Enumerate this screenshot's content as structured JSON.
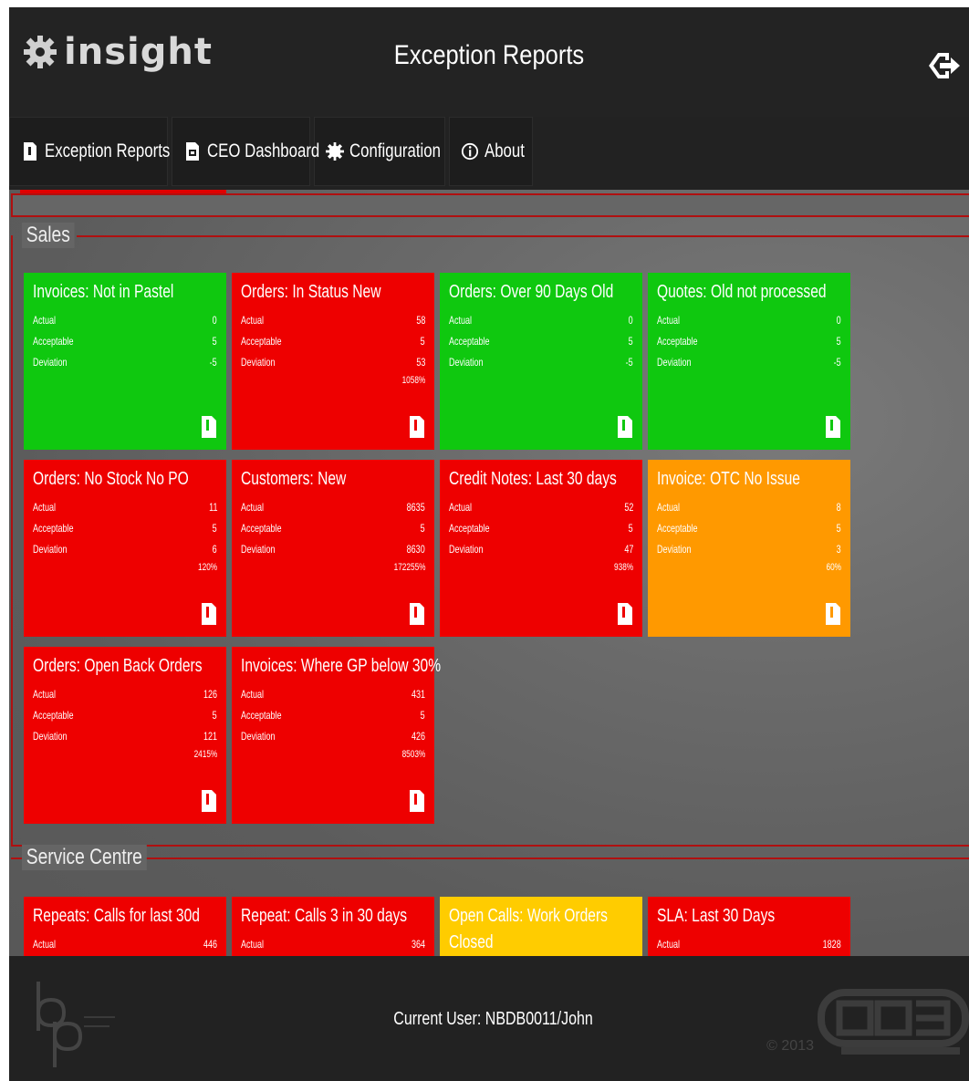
{
  "header": {
    "logo_text": "insight",
    "title": "Exception Reports"
  },
  "nav": {
    "tabs": [
      {
        "label": "Exception Reports"
      },
      {
        "label": "CEO Dashboard"
      },
      {
        "label": "Configuration"
      },
      {
        "label": "About"
      }
    ]
  },
  "groups": [
    {
      "title": "Sales",
      "tiles": [
        {
          "title": "Invoices: Not in Pastel",
          "color": "green",
          "actual_label": "Actual",
          "actual": "0",
          "acceptable_label": "Acceptable",
          "acceptable": "5",
          "deviation_label": "Deviation",
          "deviation": "-5",
          "percent": ""
        },
        {
          "title": "Orders: In Status New",
          "color": "red",
          "actual_label": "Actual",
          "actual": "58",
          "acceptable_label": "Acceptable",
          "acceptable": "5",
          "deviation_label": "Deviation",
          "deviation": "53",
          "percent": "1058%"
        },
        {
          "title": "Orders: Over 90 Days Old",
          "color": "green",
          "actual_label": "Actual",
          "actual": "0",
          "acceptable_label": "Acceptable",
          "acceptable": "5",
          "deviation_label": "Deviation",
          "deviation": "-5",
          "percent": ""
        },
        {
          "title": "Quotes: Old not processed",
          "color": "green",
          "actual_label": "Actual",
          "actual": "0",
          "acceptable_label": "Acceptable",
          "acceptable": "5",
          "deviation_label": "Deviation",
          "deviation": "-5",
          "percent": ""
        },
        {
          "title": "Orders: No Stock No PO",
          "color": "red",
          "actual_label": "Actual",
          "actual": "11",
          "acceptable_label": "Acceptable",
          "acceptable": "5",
          "deviation_label": "Deviation",
          "deviation": "6",
          "percent": "120%"
        },
        {
          "title": "Customers: New",
          "color": "red",
          "actual_label": "Actual",
          "actual": "8635",
          "acceptable_label": "Acceptable",
          "acceptable": "5",
          "deviation_label": "Deviation",
          "deviation": "8630",
          "percent": "172255%"
        },
        {
          "title": "Credit Notes: Last 30 days",
          "color": "red",
          "actual_label": "Actual",
          "actual": "52",
          "acceptable_label": "Acceptable",
          "acceptable": "5",
          "deviation_label": "Deviation",
          "deviation": "47",
          "percent": "938%"
        },
        {
          "title": "Invoice: OTC No Issue",
          "color": "orange",
          "actual_label": "Actual",
          "actual": "8",
          "acceptable_label": "Acceptable",
          "acceptable": "5",
          "deviation_label": "Deviation",
          "deviation": "3",
          "percent": "60%"
        },
        {
          "title": "Orders: Open Back Orders",
          "color": "red",
          "actual_label": "Actual",
          "actual": "126",
          "acceptable_label": "Acceptable",
          "acceptable": "5",
          "deviation_label": "Deviation",
          "deviation": "121",
          "percent": "2415%"
        },
        {
          "title": "Invoices: Where GP below 30%",
          "color": "red",
          "actual_label": "Actual",
          "actual": "431",
          "acceptable_label": "Acceptable",
          "acceptable": "5",
          "deviation_label": "Deviation",
          "deviation": "426",
          "percent": "8503%"
        }
      ]
    },
    {
      "title": "Service Centre",
      "tiles": [
        {
          "title": "Repeats: Calls for last 30d",
          "color": "red",
          "actual_label": "Actual",
          "actual": "446"
        },
        {
          "title": "Repeat: Calls 3 in 30 days",
          "color": "red",
          "actual_label": "Actual",
          "actual": "364"
        },
        {
          "title": "Open Calls: Work Orders Closed",
          "title_line1": "Open Calls: Work Orders",
          "title_line2": "Closed",
          "color": "yellow"
        },
        {
          "title": "SLA: Last 30 Days",
          "color": "red",
          "actual_label": "Actual",
          "actual": "1828"
        }
      ]
    }
  ],
  "footer": {
    "current_user": "Current User: NBDB0011/John",
    "copyright": "© 2013"
  },
  "colors": {
    "green": "#0fc80f",
    "red": "#ee0000",
    "orange": "#ff9900",
    "yellow": "#ffcc00",
    "accent": "#e00000"
  },
  "icons": [
    "gear-logo-icon",
    "logout-icon",
    "report-doc-icon",
    "dashboard-icon",
    "gear-icon",
    "info-icon"
  ]
}
